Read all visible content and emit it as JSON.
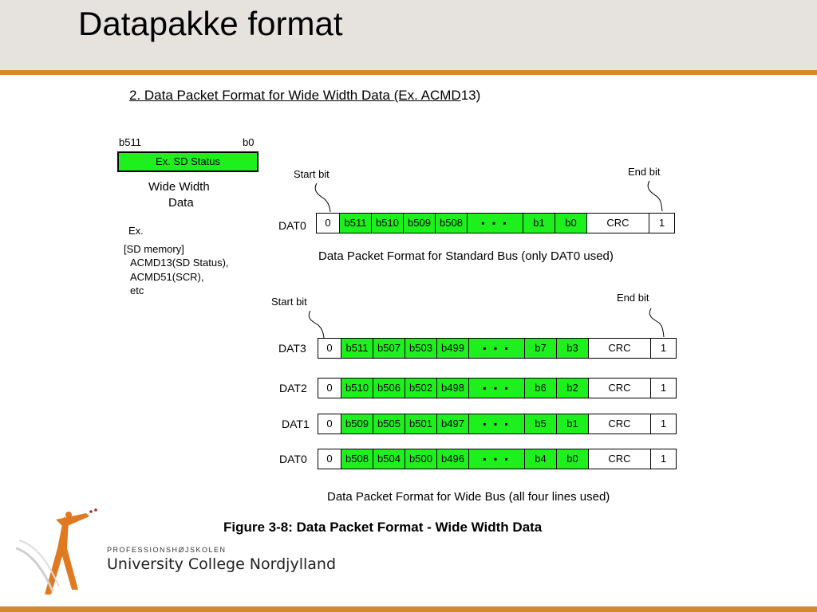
{
  "slide": {
    "title": "Datapakke format"
  },
  "figure": {
    "heading_underlined": "2. Data Packet Format for Wide Width Data (Ex. ACMD",
    "heading_tail": "13)",
    "caption": "Figure 3-8: Data Packet Format - Wide Width Data"
  },
  "left_block": {
    "msb_label": "b511",
    "lsb_label": "b0",
    "box_label": "Ex. SD Status",
    "desc_line1": "Wide Width",
    "desc_line2": "Data",
    "ex_label": "Ex.",
    "mem_line1": "[SD memory]",
    "mem_line2": "ACMD13(SD Status),",
    "mem_line3": "ACMD51(SCR),",
    "mem_line4": "etc"
  },
  "standard_bus": {
    "start_label": "Start bit",
    "end_label": "End bit",
    "caption": "Data Packet Format for Standard Bus (only DAT0 used)",
    "row": {
      "line": "DAT0",
      "cells": [
        "0",
        "b511",
        "b510",
        "b509",
        "b508",
        "▪ ▪ ▪",
        "b1",
        "b0",
        "CRC",
        "1"
      ]
    }
  },
  "wide_bus": {
    "start_label": "Start bit",
    "end_label": "End bit",
    "caption": "Data Packet Format for Wide Bus (all four lines used)",
    "rows": [
      {
        "line": "DAT3",
        "cells": [
          "0",
          "b511",
          "b507",
          "b503",
          "b499",
          "▪ ▪ ▪",
          "b7",
          "b3",
          "CRC",
          "1"
        ]
      },
      {
        "line": "DAT2",
        "cells": [
          "0",
          "b510",
          "b506",
          "b502",
          "b498",
          "▪ ▪ ▪",
          "b6",
          "b2",
          "CRC",
          "1"
        ]
      },
      {
        "line": "DAT1",
        "cells": [
          "0",
          "b509",
          "b505",
          "b501",
          "b497",
          "▪ ▪ ▪",
          "b5",
          "b1",
          "CRC",
          "1"
        ]
      },
      {
        "line": "DAT0",
        "cells": [
          "0",
          "b508",
          "b504",
          "b500",
          "b496",
          "▪ ▪ ▪",
          "b4",
          "b0",
          "CRC",
          "1"
        ]
      }
    ]
  },
  "logo": {
    "line1": "PROFESSIONSHØJSKOLEN",
    "line2": "University College Nordjylland"
  },
  "colors": {
    "accent": "#d38a2f",
    "data_fill": "#1ef01e",
    "title_bg": "#e6e3df"
  }
}
